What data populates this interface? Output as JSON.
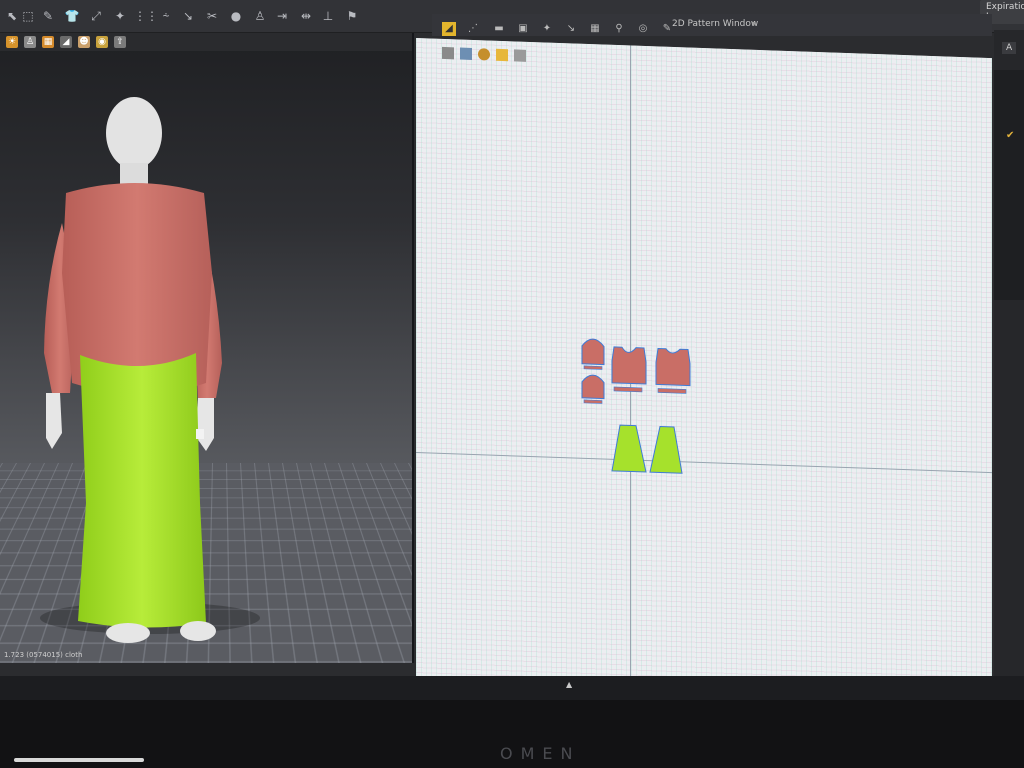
{
  "window": {
    "pattern_title": "2D Pattern Window",
    "expiration_label": "Expiration I",
    "right_tab": "A"
  },
  "viewport3d": {
    "status": "1.723 (0574015)  cloth"
  },
  "colors": {
    "shirt": "#c96e66",
    "skirt": "#a6e12c",
    "avatar": "#e6e6e6",
    "pattern_outline": "#3f7bd6"
  },
  "toolbar_icons": [
    "pointer-icon",
    "select-icon",
    "pen-icon",
    "shirt-icon",
    "walk-icon",
    "grid-icon",
    "brush-icon",
    "tape-icon",
    "sphere-icon",
    "avatar-icon",
    "arrows-icon",
    "mirror-icon",
    "pin-icon",
    "run-icon"
  ],
  "pattern_toolbar_icons": [
    "edit-icon",
    "transform-icon",
    "rect-icon",
    "curve-icon",
    "segment-icon",
    "dart-icon",
    "internal-line-icon",
    "notch-icon",
    "stitch-icon",
    "seam-icon",
    "bars-icon",
    "grid-dots-icon",
    "tshirt-icon"
  ]
}
